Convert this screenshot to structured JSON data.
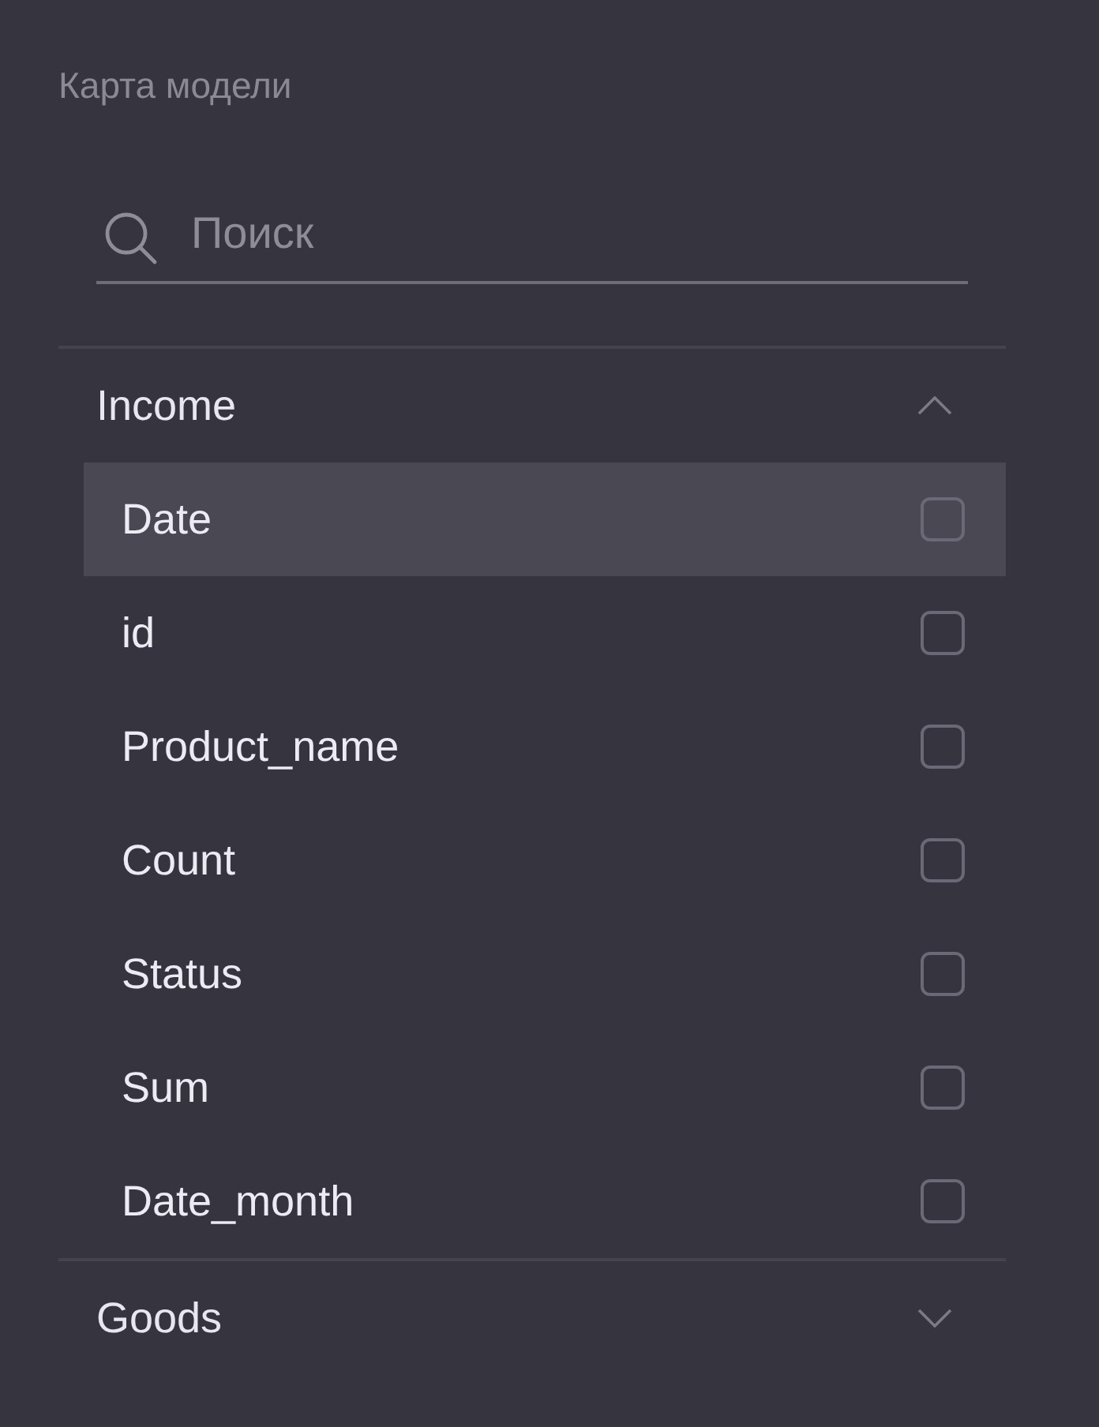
{
  "panel": {
    "title": "Карта модели"
  },
  "search": {
    "placeholder": "Поиск"
  },
  "groups": [
    {
      "label": "Income",
      "expanded": true,
      "items": [
        {
          "label": "Date",
          "selected": true,
          "checked": false
        },
        {
          "label": "id",
          "selected": false,
          "checked": false
        },
        {
          "label": "Product_name",
          "selected": false,
          "checked": false
        },
        {
          "label": "Count",
          "selected": false,
          "checked": false
        },
        {
          "label": "Status",
          "selected": false,
          "checked": false
        },
        {
          "label": "Sum",
          "selected": false,
          "checked": false
        },
        {
          "label": "Date_month",
          "selected": false,
          "checked": false
        }
      ]
    },
    {
      "label": "Goods",
      "expanded": false
    }
  ]
}
